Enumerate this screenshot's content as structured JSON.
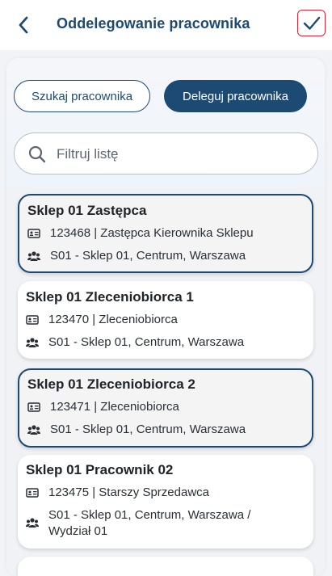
{
  "header": {
    "title": "Oddelegowanie pracownika"
  },
  "tabs": {
    "search_label": "Szukaj pracownika",
    "delegate_label": "Deleguj pracownika"
  },
  "filter": {
    "placeholder": "Filtruj listę",
    "value": ""
  },
  "employees": [
    {
      "name": "Sklep 01 Zastępca",
      "id_role": "123468 | Zastępca Kierownika Sklepu",
      "location": "S01 - Sklep 01, Centrum, Warszawa",
      "selected": true
    },
    {
      "name": "Sklep 01 Zleceniobiorca 1",
      "id_role": "123470 | Zleceniobiorca",
      "location": "S01 - Sklep 01, Centrum, Warszawa",
      "selected": false
    },
    {
      "name": "Sklep 01 Zleceniobiorca 2",
      "id_role": "123471 | Zleceniobiorca",
      "location": "S01 - Sklep 01, Centrum, Warszawa",
      "selected": true
    },
    {
      "name": "Sklep 01 Pracownik 02",
      "id_role": "123475 | Starszy Sprzedawca",
      "location": "S01 - Sklep 01, Centrum, Warszawa / Wydział 01",
      "selected": false
    }
  ],
  "colors": {
    "primary": "#1d4a73",
    "confirm_border": "#e0202e",
    "background": "#f0f2f5"
  }
}
